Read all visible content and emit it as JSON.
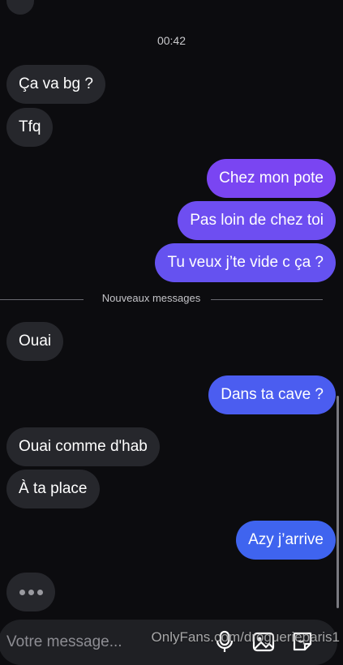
{
  "timestamp": "00:42",
  "messages": [
    {
      "text": "Ça va bg ?",
      "direction": "in"
    },
    {
      "text": "Tfq",
      "direction": "in"
    },
    {
      "text": "Chez mon pote",
      "direction": "out"
    },
    {
      "text": "Pas loin de chez toi",
      "direction": "out"
    },
    {
      "text": "Tu veux j’te vide c ça ?",
      "direction": "out"
    },
    {
      "text": "Ouai",
      "direction": "in"
    },
    {
      "text": "Dans ta cave ?",
      "direction": "out"
    },
    {
      "text": "Ouai comme d'hab",
      "direction": "in"
    },
    {
      "text": "À ta place",
      "direction": "in"
    },
    {
      "text": "Azy j’arrive",
      "direction": "out"
    }
  ],
  "divider_label": "Nouveaux messages",
  "composer": {
    "placeholder": "Votre message...",
    "icons": [
      "microphone-icon",
      "image-icon",
      "sticker-icon"
    ]
  },
  "watermark": "OnlyFans.com/droguerieparis1",
  "colors": {
    "background": "#0c0c0f",
    "incoming_bubble": "#26272c",
    "outgoing_top": "#7a45f2",
    "outgoing_bottom": "#3f64ef",
    "text": "#ffffff"
  }
}
